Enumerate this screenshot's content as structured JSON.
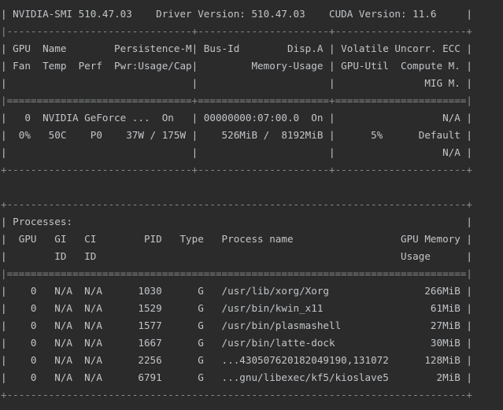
{
  "lines": [
    "| NVIDIA-SMI 510.47.03    Driver Version: 510.47.03    CUDA Version: 11.6     |",
    "|-------------------------------+----------------------+----------------------+",
    "| GPU  Name        Persistence-M| Bus-Id        Disp.A | Volatile Uncorr. ECC |",
    "| Fan  Temp  Perf  Pwr:Usage/Cap|         Memory-Usage | GPU-Util  Compute M. |",
    "|                               |                      |               MIG M. |",
    "|===============================+======================+======================|",
    "|   0  NVIDIA GeForce ...  On   | 00000000:07:00.0  On |                  N/A |",
    "|  0%   50C    P0    37W / 175W |    526MiB /  8192MiB |      5%      Default |",
    "|                               |                      |                  N/A |",
    "+-------------------------------+----------------------+----------------------+",
    "",
    "+-----------------------------------------------------------------------------+",
    "| Processes:                                                                  |",
    "|  GPU   GI   CI        PID   Type   Process name                  GPU Memory |",
    "|        ID   ID                                                   Usage      |",
    "|=============================================================================|",
    "|    0   N/A  N/A      1030      G   /usr/lib/xorg/Xorg                266MiB |",
    "|    0   N/A  N/A      1529      G   /usr/bin/kwin_x11                  61MiB |",
    "|    0   N/A  N/A      1577      G   /usr/bin/plasmashell               27MiB |",
    "|    0   N/A  N/A      1667      G   /usr/bin/latte-dock                30MiB |",
    "|    0   N/A  N/A      2256      G   ...430507620182049190,131072      128MiB |",
    "|    0   N/A  N/A      6791      G   ...gnu/libexec/kf5/kioslave5        2MiB |",
    "+-----------------------------------------------------------------------------+"
  ],
  "colors": {
    "background": "#2b2b2b",
    "text": "#c2c5c9",
    "border": "#8a8d91"
  }
}
